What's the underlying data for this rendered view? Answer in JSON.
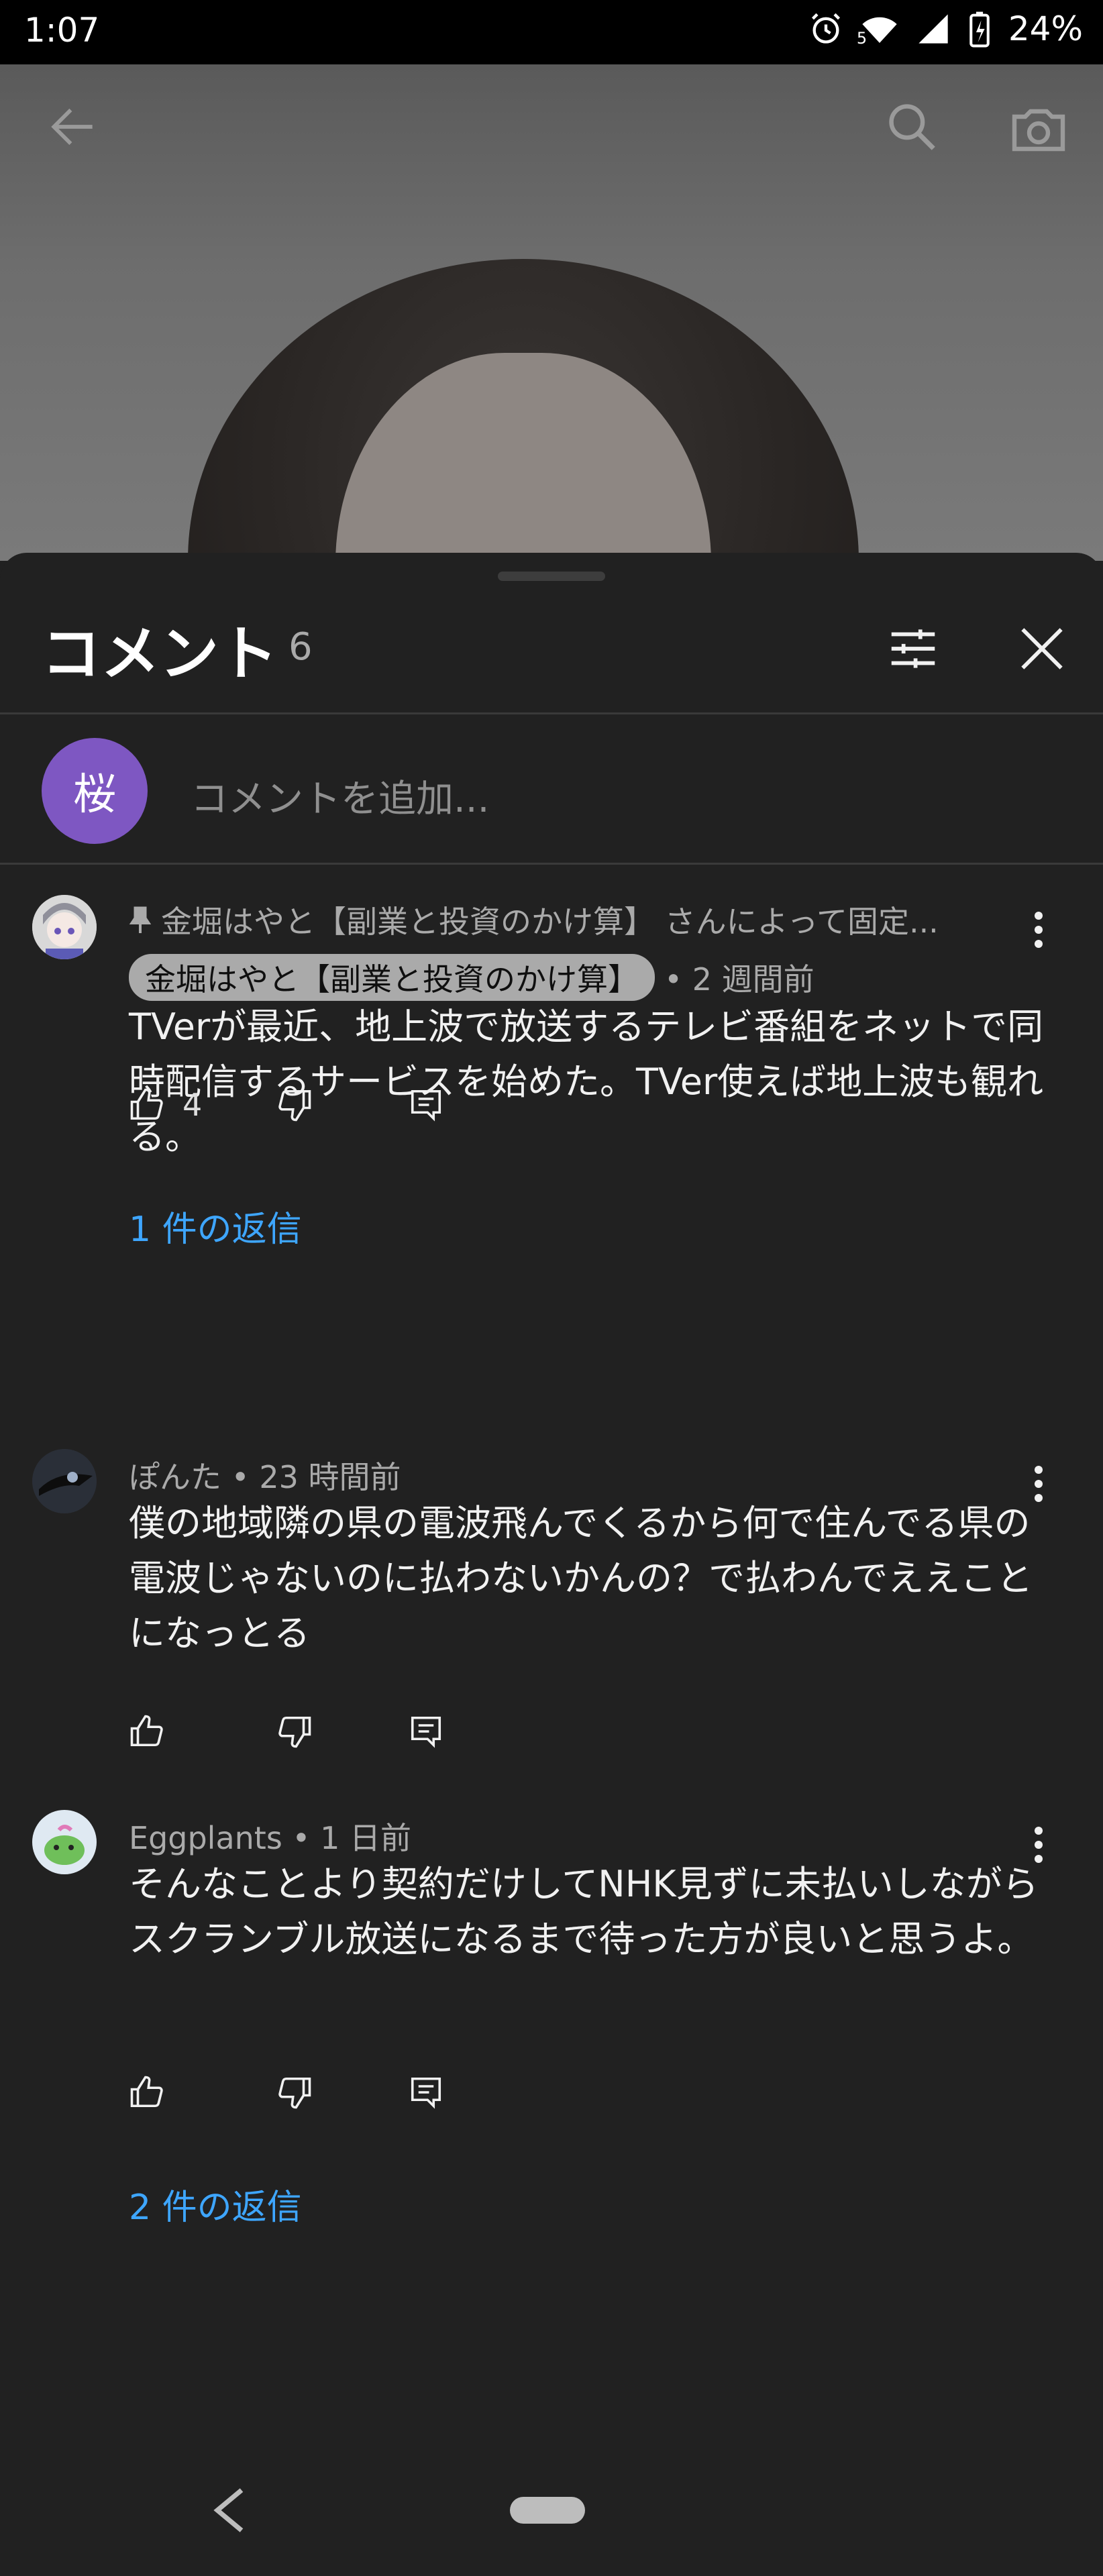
{
  "status_bar": {
    "time": "1:07",
    "battery_percent": "24%",
    "network_label": "5"
  },
  "sheet": {
    "title": "コメント",
    "count": "6",
    "add_comment_placeholder": "コメントを追加...",
    "user_avatar_letter": "桜",
    "user_avatar_color": "#7e57c2"
  },
  "comments": [
    {
      "pinned_label": "金堀はやと【副業と投資のかけ算】 さんによって固定...",
      "author": "金堀はやと【副業と投資のかけ算】",
      "time": "• 2 週間前",
      "text": "TVerが最近、地上波で放送するテレビ番組をネットで同時配信するサービスを始めた。TVer使えば地上波も観れる。",
      "likes": "4",
      "replies": "1 件の返信"
    },
    {
      "meta": "ぽんた • 23 時間前",
      "text": "僕の地域隣の県の電波飛んでくるから何で住んでる県の電波じゃないのに払わないかんの？で払わんでええことになっとる"
    },
    {
      "meta": "Eggplants • 1 日前",
      "text": "そんなことより契約だけしてNHK見ずに未払いしながらスクランブル放送になるまで待った方が良いと思うよ。",
      "replies": "2 件の返信"
    }
  ],
  "colors": {
    "accent_link": "#3ea6ff",
    "background": "#212121"
  }
}
